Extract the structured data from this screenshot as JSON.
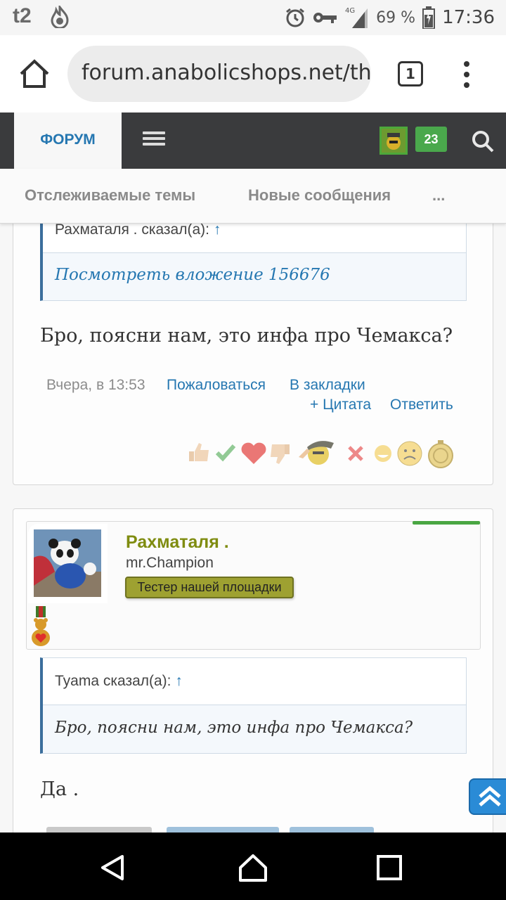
{
  "status_bar": {
    "carrier": "t2",
    "network": "4G",
    "battery_percent": "69 %",
    "time": "17:36"
  },
  "browser": {
    "url": "forum.anabolicshops.net/th",
    "tab_count": "1"
  },
  "forum_nav": {
    "forum_tab": "ФОРУМ",
    "alerts_count": "23"
  },
  "sub_nav": {
    "watched_threads": "Отслеживаемые темы",
    "new_posts": "Новые сообщения",
    "more": "..."
  },
  "post1": {
    "quote_author_line": "Рахматаля . сказал(а): ",
    "quote_arrow": "↑",
    "quote_attachment": "Посмотреть вложение 156676",
    "message": "Бро, поясни нам, это инфа про Чемакса?",
    "time": "Вчера, в 13:53",
    "report": "Пожаловаться",
    "bookmark": "В закладки",
    "quote_action": "+ Цитата",
    "reply": "Ответить",
    "reactions": [
      "thumbs-up",
      "check",
      "heart",
      "thumbs-down",
      "salute",
      "cross",
      "laugh",
      "sad",
      "medal"
    ]
  },
  "post2": {
    "username": "Рахматаля .",
    "user_title": "mr.Champion",
    "user_banner": "Тестер нашей площадки",
    "quote_author_line": "Tyama сказал(а): ",
    "quote_arrow": "↑",
    "quote_text": "Бро, поясни нам, это инфа про Чемакса?",
    "message": "Да ."
  },
  "colors": {
    "link": "#2577b1",
    "nav_bg": "#3a3b3d",
    "username": "#7f8c10",
    "banner": "#9ea131",
    "alert_badge": "#4aa84c"
  }
}
